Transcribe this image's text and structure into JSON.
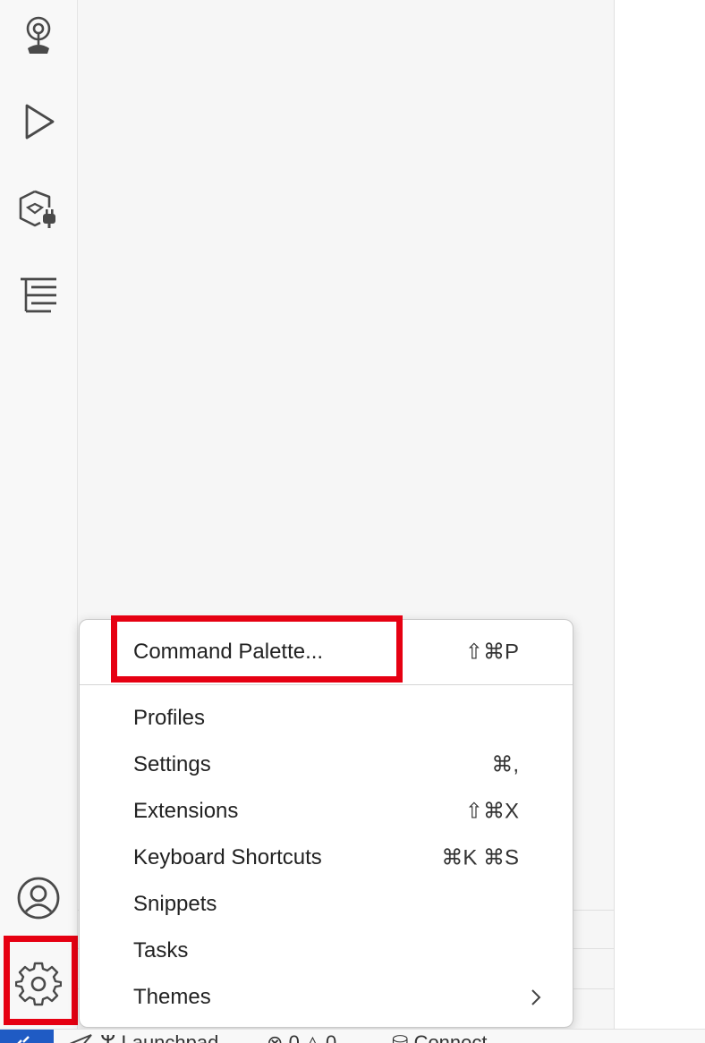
{
  "activity_bar": {
    "icons": [
      "remote-explorer-icon",
      "run-debug-icon",
      "extensions-icon",
      "outline-icon",
      "accounts-icon",
      "manage-gear-icon"
    ]
  },
  "menu": {
    "items": [
      {
        "label": "Command Palette...",
        "shortcut": "⇧⌘P"
      },
      {
        "label": "Profiles",
        "shortcut": ""
      },
      {
        "label": "Settings",
        "shortcut": "⌘,"
      },
      {
        "label": "Extensions",
        "shortcut": "⇧⌘X"
      },
      {
        "label": "Keyboard Shortcuts",
        "shortcut": "⌘K ⌘S"
      },
      {
        "label": "Snippets",
        "shortcut": ""
      },
      {
        "label": "Tasks",
        "shortcut": ""
      },
      {
        "label": "Themes",
        "shortcut": ""
      }
    ]
  },
  "statusbar": {
    "branch": "Launchpad",
    "errors": "0",
    "warnings": "0",
    "connect": "Connect"
  },
  "colors": {
    "highlight": "#e60012",
    "remote_indicator": "#1f5bc4"
  }
}
